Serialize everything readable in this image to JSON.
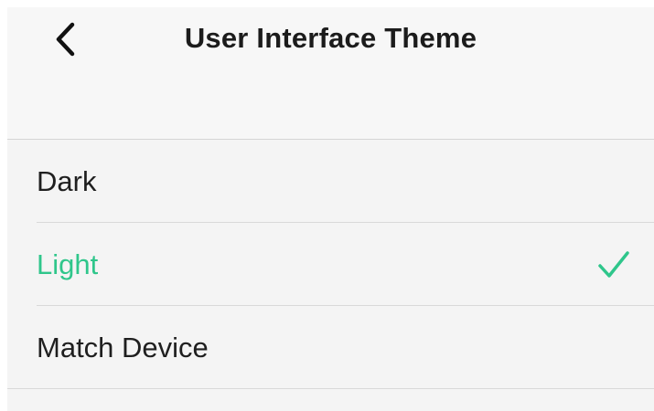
{
  "header": {
    "title": "User Interface Theme",
    "back_icon": "chevron-left-icon"
  },
  "options": [
    {
      "label": "Dark",
      "selected": false
    },
    {
      "label": "Light",
      "selected": true
    },
    {
      "label": "Match Device",
      "selected": false
    }
  ],
  "colors": {
    "accent": "#2fc68b",
    "text": "#1f1f1f",
    "background": "#f4f4f4",
    "header_background": "#f7f7f7",
    "divider": "#d9d9d9"
  },
  "selected_icon": "checkmark-icon"
}
